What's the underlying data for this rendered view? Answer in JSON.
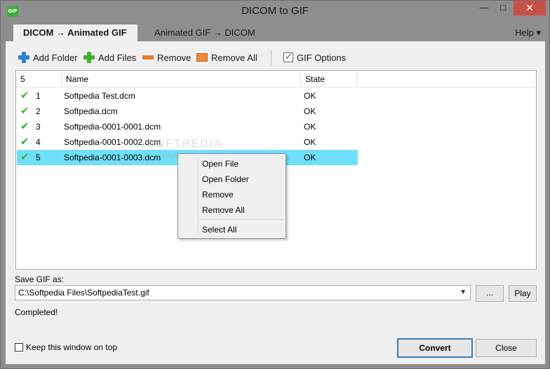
{
  "window": {
    "title": "DICOM to GIF",
    "app_icon_text": "GIF",
    "minimize": "—",
    "maximize": "□",
    "close": "✕"
  },
  "tabs": [
    {
      "label": "DICOM → Animated GIF",
      "active": true
    },
    {
      "label": "Animated GIF → DICOM",
      "active": false
    }
  ],
  "help": {
    "label": "Help ▾"
  },
  "toolbar": {
    "add_folder": "Add Folder",
    "add_files": "Add Files",
    "remove": "Remove",
    "remove_all": "Remove All",
    "gif_options": "GIF Options"
  },
  "list": {
    "count_header": "5",
    "name_header": "Name",
    "state_header": "State",
    "rows": [
      {
        "num": "1",
        "name": "Softpedia Test.dcm",
        "state": "OK",
        "check": "✔"
      },
      {
        "num": "2",
        "name": "Softpedia.dcm",
        "state": "OK",
        "check": "✔"
      },
      {
        "num": "3",
        "name": "Softpedia-0001-0001.dcm",
        "state": "OK",
        "check": "✔"
      },
      {
        "num": "4",
        "name": "Softpedia-0001-0002.dcm",
        "state": "OK",
        "check": "✔"
      },
      {
        "num": "5",
        "name": "Softpedia-0001-0003.dcm",
        "state": "OK",
        "check": "✔"
      }
    ],
    "selected_index": 4
  },
  "watermark": {
    "text": "SOFTPEDIA",
    "url": "www.softpedia.com"
  },
  "context_menu": {
    "items": [
      "Open File",
      "Open Folder",
      "Remove",
      "Remove All",
      "Select All"
    ]
  },
  "output": {
    "save_label": "Save GIF as:",
    "path": "C:\\Softpedia Files\\SoftpediaTest.gif",
    "browse": "...",
    "play": "Play",
    "status": "Completed!"
  },
  "footer": {
    "keep_on_top": "Keep this window on top",
    "keep_on_top_checked": false,
    "convert": "Convert",
    "close": "Close"
  },
  "colors": {
    "selection": "#70e0fa",
    "titlebar": "#8e8e8e",
    "close_button": "#c7514a",
    "check_green": "#3cae3c"
  }
}
